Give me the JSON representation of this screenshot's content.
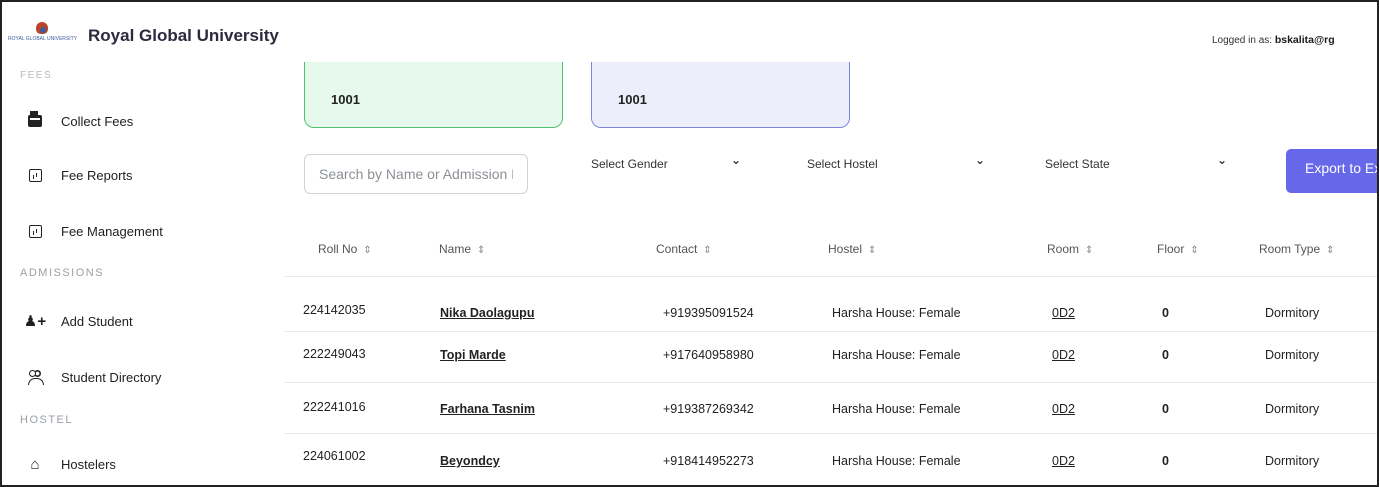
{
  "header": {
    "logo_text": "ROYAL GLOBAL UNIVERSITY",
    "brand": "Royal Global University",
    "logged_in_label": "Logged in as:",
    "logged_in_user": "bskalita@rg"
  },
  "sidebar": {
    "sections": {
      "fees": "FEES",
      "admissions": "ADMISSIONS",
      "hostel": "HOSTEL"
    },
    "items": [
      {
        "label": "Collect Fees",
        "icon": "cash-register-icon"
      },
      {
        "label": "Fee Reports",
        "icon": "chart-box-icon"
      },
      {
        "label": "Fee Management",
        "icon": "chart-box-icon"
      },
      {
        "label": "Add Student",
        "icon": "add-user-icon"
      },
      {
        "label": "Student Directory",
        "icon": "users-icon"
      },
      {
        "label": "Hostelers",
        "icon": "home-icon"
      }
    ]
  },
  "cards": [
    {
      "value": "1001",
      "color": "#e7f8ec"
    },
    {
      "value": "1001",
      "color": "#eceffb"
    }
  ],
  "filters": {
    "search_placeholder": "Search by Name or Admission No",
    "gender": "Select Gender",
    "hostel": "Select Hostel",
    "state": "Select State",
    "chevron": "⌄",
    "export_label": "Export to Excel"
  },
  "table": {
    "sort_glyph": "⇕",
    "columns": [
      "Roll No",
      "Name",
      "Contact",
      "Hostel",
      "Room",
      "Floor",
      "Room Type"
    ],
    "rows": [
      {
        "roll": "224142035",
        "name": "Nika Daolagupu",
        "contact": "+919395091524",
        "hostel": "Harsha House: Female",
        "room": "0D2",
        "floor": "0",
        "type": "Dormitory"
      },
      {
        "roll": "222249043",
        "name": "Topi Marde",
        "contact": "+917640958980",
        "hostel": "Harsha House: Female",
        "room": "0D2",
        "floor": "0",
        "type": "Dormitory"
      },
      {
        "roll": "222241016",
        "name": "Farhana Tasnim",
        "contact": "+919387269342",
        "hostel": "Harsha House: Female",
        "room": "0D2",
        "floor": "0",
        "type": "Dormitory"
      },
      {
        "roll": "224061002",
        "name": "Beyondcy",
        "contact": "+918414952273",
        "hostel": "Harsha House: Female",
        "room": "0D2",
        "floor": "0",
        "type": "Dormitory"
      }
    ]
  },
  "colors": {
    "accent": "#6667e9",
    "card_green_border": "#4fbf72",
    "card_purple_border": "#7b86d8"
  }
}
